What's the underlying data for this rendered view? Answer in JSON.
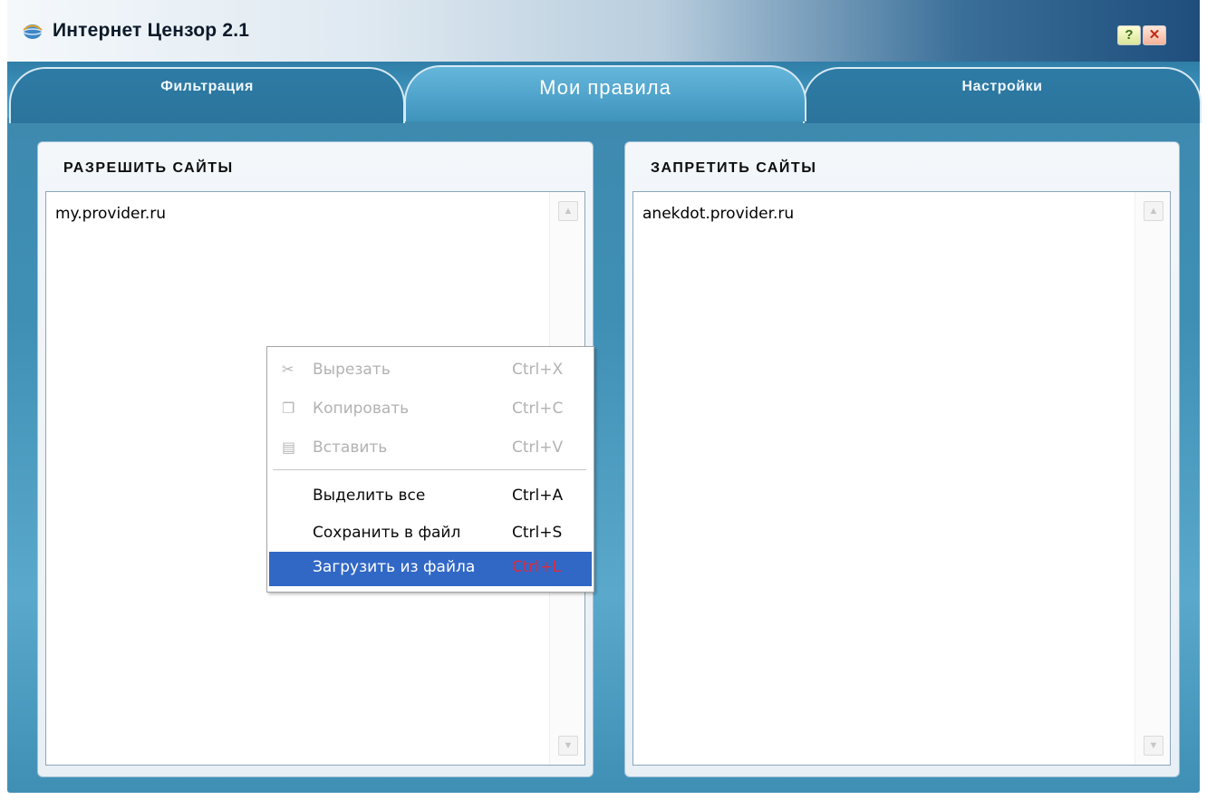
{
  "window": {
    "title": "Интернет Цензор 2.1",
    "icons": {
      "app": "globe-icon",
      "help": "help-icon",
      "close": "close-icon"
    },
    "help_label": "?",
    "close_label": "✕"
  },
  "tabs": [
    {
      "label": "Фильтрация",
      "active": false
    },
    {
      "label": "Мои правила",
      "active": true
    },
    {
      "label": "Настройки",
      "active": false
    }
  ],
  "allow_panel": {
    "title": "РАЗРЕШИТЬ САЙТЫ",
    "items": [
      "my.provider.ru"
    ]
  },
  "deny_panel": {
    "title": "ЗАПРЕТИТЬ САЙТЫ",
    "items": [
      "anekdot.provider.ru"
    ]
  },
  "context_menu": {
    "items": [
      {
        "label": "Вырезать",
        "shortcut": "Ctrl+X",
        "enabled": false,
        "icon": "scissors-icon"
      },
      {
        "label": "Копировать",
        "shortcut": "Ctrl+C",
        "enabled": false,
        "icon": "copy-icon"
      },
      {
        "label": "Вставить",
        "shortcut": "Ctrl+V",
        "enabled": false,
        "icon": "paste-icon"
      },
      {
        "label": "Выделить все",
        "shortcut": "Ctrl+A",
        "enabled": true
      },
      {
        "label": "Сохранить в файл",
        "shortcut": "Ctrl+S",
        "enabled": true
      },
      {
        "label": "Загрузить из файла",
        "shortcut": "Ctrl+L",
        "enabled": true,
        "highlighted": true
      }
    ]
  },
  "colors": {
    "accent_blue": "#3f8fb5",
    "menu_highlight": "#3168c6",
    "shortcut_highlight": "#e0283c"
  }
}
